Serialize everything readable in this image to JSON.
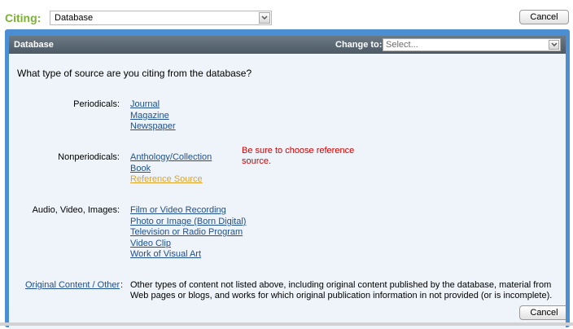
{
  "toolbar": {
    "citing_label": "Citing:",
    "citing_value": "Database",
    "cancel_label": "Cancel"
  },
  "panel": {
    "title": "Database",
    "change_to_label": "Change to:",
    "change_to_placeholder": "Select...",
    "question": "What type of source are you citing from the database?",
    "periodicals": {
      "label": "Periodicals:",
      "items": [
        "Journal",
        "Magazine",
        "Newspaper"
      ]
    },
    "nonperiodicals": {
      "label": "Nonperiodicals:",
      "items": [
        "Anthology/Collection",
        "Book",
        "Reference Source"
      ]
    },
    "hint": "Be sure to choose reference source.",
    "audio_video": {
      "label": "Audio, Video, Images:",
      "items": [
        "Film or Video Recording",
        "Photo or Image (Born Digital)",
        "Television or Radio Program",
        "Video Clip",
        "Work of Visual Art"
      ]
    },
    "other": {
      "link": "Original Content / Other",
      "colon": ":",
      "description": "Other types of content not listed above, including original content published by the database, material from Web pages or blogs, and works for which original publication information in not provided (or is incomplete)."
    },
    "cancel_label": "Cancel"
  },
  "colors": {
    "citing_label": "#7ab233",
    "link": "#1f4f8e",
    "link_highlight": "#e0a22a",
    "hint": "#d40000",
    "panel_border": "#4c8ed2"
  },
  "icons": {
    "dropdown": "chevron-down-icon"
  }
}
